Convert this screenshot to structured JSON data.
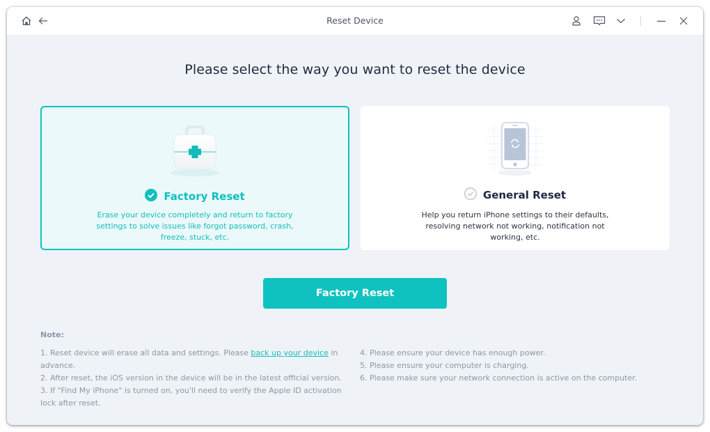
{
  "window": {
    "title": "Reset Device",
    "icons": {
      "home": "home-icon",
      "back": "back-arrow-icon",
      "account": "user-icon",
      "feedback": "chat-bubble-icon",
      "menu": "chevron-down-icon",
      "minimize": "minimize-icon",
      "close": "close-icon"
    }
  },
  "main": {
    "heading": "Please select the way you want to reset the device",
    "options": [
      {
        "id": "factory",
        "title": "Factory Reset",
        "description": "Erase your device completely and return to factory settings to solve issues like forgot password, crash, freeze, stuck, etc.",
        "selected": true,
        "icon": "medical-kit-icon"
      },
      {
        "id": "general",
        "title": "General Reset",
        "description": "Help you return iPhone settings to their defaults, resolving network not working, notification not working, etc.",
        "selected": false,
        "icon": "phone-refresh-icon"
      }
    ],
    "action_button": "Factory Reset"
  },
  "notes": {
    "label": "Note:",
    "left": {
      "n1_prefix": "1. Reset device will erase all data and settings. Please ",
      "n1_link": "back up your device",
      "n1_suffix": " in advance.",
      "n2": "2. After reset, the iOS version in the device will be in the latest official version.",
      "n3": "3. If \"Find My iPhone\" is turned on, you'll need to verify the Apple ID activation lock after reset."
    },
    "right": [
      "4. Please ensure your device has enough power.",
      "5. Please ensure your computer is charging.",
      "6. Please make sure your network connection is active on the computer."
    ]
  },
  "colors": {
    "accent": "#0fc2bf",
    "heading": "#1f2a3d",
    "note_text": "#8d96a3",
    "background": "#eff3f8"
  }
}
